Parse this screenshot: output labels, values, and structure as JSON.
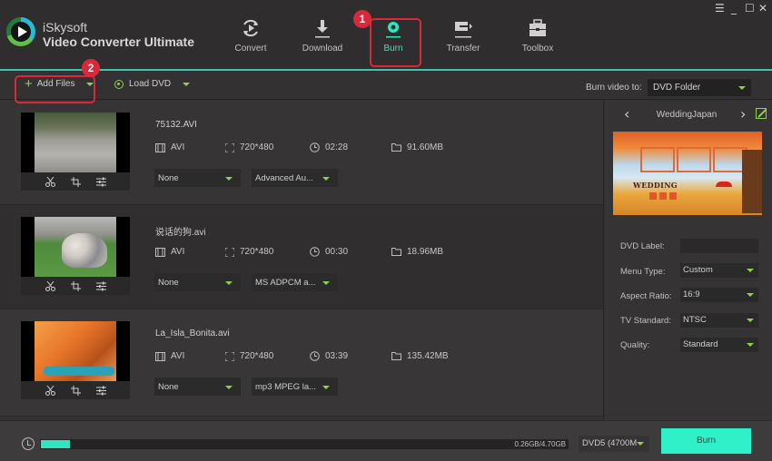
{
  "app": {
    "brand_line1": "iSkysoft",
    "brand_line2": "Video Converter Ultimate"
  },
  "window_controls": {
    "menu": "☰",
    "minimize": "_",
    "maximize": "☐",
    "close": "✕"
  },
  "nav": {
    "items": [
      {
        "label": "Convert",
        "icon": "convert-icon",
        "active": false
      },
      {
        "label": "Download",
        "icon": "download-icon",
        "active": false
      },
      {
        "label": "Burn",
        "icon": "burn-icon",
        "active": true
      },
      {
        "label": "Transfer",
        "icon": "transfer-icon",
        "active": false
      },
      {
        "label": "Toolbox",
        "icon": "toolbox-icon",
        "active": false
      }
    ]
  },
  "annotations": {
    "badge_1": "1",
    "badge_2": "2"
  },
  "toolbar": {
    "add_files": "Add Files",
    "load_dvd": "Load DVD",
    "burn_to_label": "Burn video to:",
    "burn_to_value": "DVD Folder"
  },
  "files": [
    {
      "name": "75132.AVI",
      "format": "AVI",
      "resolution": "720*480",
      "duration": "02:28",
      "size": "91.60MB",
      "subtitle": "None",
      "audio": "Advanced Au..."
    },
    {
      "name": "说话的狗.avi",
      "format": "AVI",
      "resolution": "720*480",
      "duration": "00:30",
      "size": "18.96MB",
      "subtitle": "None",
      "audio": "MS ADPCM a..."
    },
    {
      "name": "La_Isla_Bonita.avi",
      "format": "AVI",
      "resolution": "720*480",
      "duration": "03:39",
      "size": "135.42MB",
      "subtitle": "None",
      "audio": "mp3 MPEG la..."
    }
  ],
  "template": {
    "prev": "‹",
    "next": "›",
    "name": "WeddingJapan",
    "preview_title": "WEDDING"
  },
  "options": {
    "dvd_label": {
      "label": "DVD Label:",
      "value": ""
    },
    "menu_type": {
      "label": "Menu Type:",
      "value": "Custom"
    },
    "aspect_ratio": {
      "label": "Aspect Ratio:",
      "value": "16:9"
    },
    "tv_standard": {
      "label": "TV Standard:",
      "value": "NTSC"
    },
    "quality": {
      "label": "Quality:",
      "value": "Standard"
    }
  },
  "bottom": {
    "usage_text": "0.26GB/4.70GB",
    "usage_fraction": 0.055,
    "disc_type": "DVD5 (4700M",
    "burn_label": "Burn"
  },
  "colors": {
    "accent": "#2fe6c0",
    "highlight": "#d9283a",
    "dropdown_arrow": "#8fd14f"
  }
}
